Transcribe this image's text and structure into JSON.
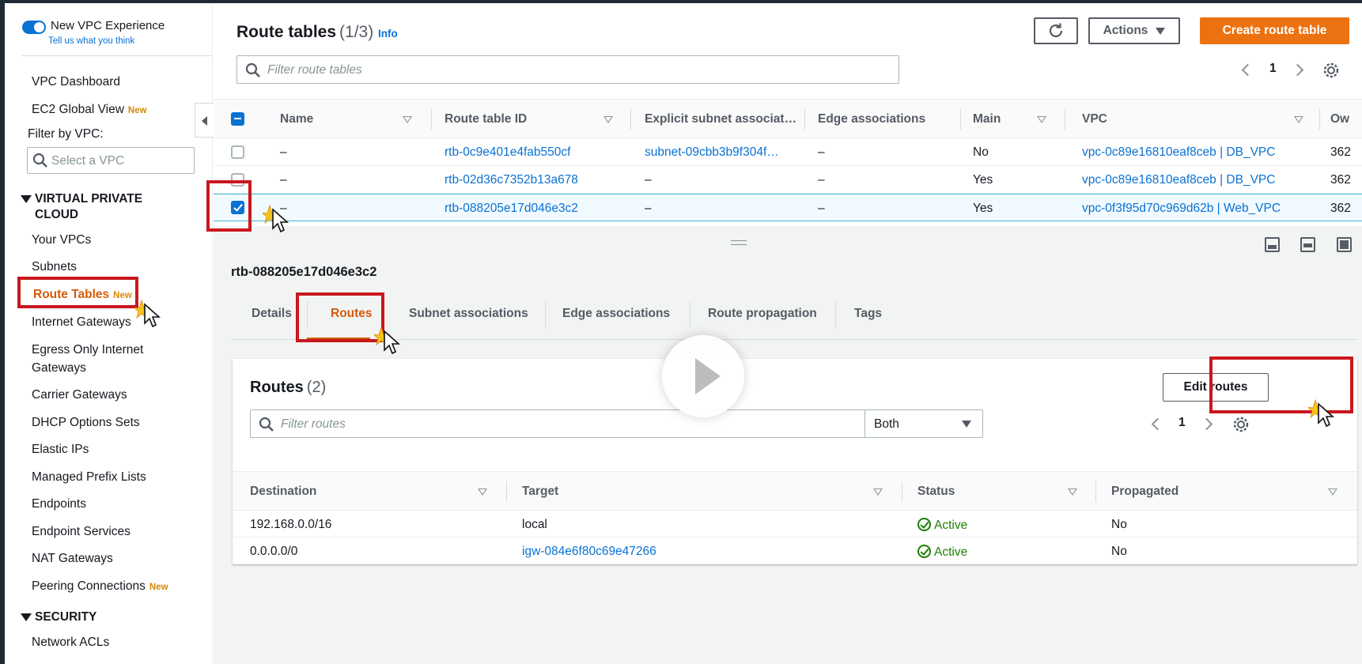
{
  "sidebar": {
    "toggle_label": "New VPC Experience",
    "feedback_link": "Tell us what you think",
    "items_top": [
      {
        "label": "VPC Dashboard",
        "badge": ""
      },
      {
        "label": "EC2 Global View",
        "badge": "New"
      }
    ],
    "filter_label": "Filter by VPC:",
    "filter_placeholder": "Select a VPC",
    "section_vpc": "VIRTUAL PRIVATE CLOUD",
    "vpc_items": [
      {
        "label": "Your VPCs",
        "badge": ""
      },
      {
        "label": "Subnets",
        "badge": ""
      },
      {
        "label": "Route Tables",
        "badge": "New",
        "active": true
      },
      {
        "label": "Internet Gateways",
        "badge": ""
      },
      {
        "label": "Egress Only Internet Gateways",
        "badge": ""
      },
      {
        "label": "Carrier Gateways",
        "badge": ""
      },
      {
        "label": "DHCP Options Sets",
        "badge": ""
      },
      {
        "label": "Elastic IPs",
        "badge": ""
      },
      {
        "label": "Managed Prefix Lists",
        "badge": ""
      },
      {
        "label": "Endpoints",
        "badge": ""
      },
      {
        "label": "Endpoint Services",
        "badge": ""
      },
      {
        "label": "NAT Gateways",
        "badge": ""
      },
      {
        "label": "Peering Connections",
        "badge": "New"
      }
    ],
    "section_security": "SECURITY",
    "security_items": [
      {
        "label": "Network ACLs",
        "badge": ""
      }
    ]
  },
  "header": {
    "title": "Route tables",
    "count": "(1/3)",
    "info": "Info",
    "actions_label": "Actions",
    "create_label": "Create route table",
    "search_placeholder": "Filter route tables",
    "page": "1"
  },
  "table": {
    "columns": [
      "Name",
      "Route table ID",
      "Explicit subnet associat…",
      "Edge associations",
      "Main",
      "VPC",
      "Ow"
    ],
    "rows": [
      {
        "name": "–",
        "id": "rtb-0c9e401e4fab550cf",
        "subnet": "subnet-09cbb3b9f304f…",
        "edge": "–",
        "main": "No",
        "vpc": "vpc-0c89e16810eaf8ceb | DB_VPC",
        "owner": "362",
        "selected": false
      },
      {
        "name": "–",
        "id": "rtb-02d36c7352b13a678",
        "subnet": "–",
        "edge": "–",
        "main": "Yes",
        "vpc": "vpc-0c89e16810eaf8ceb | DB_VPC",
        "owner": "362",
        "selected": false
      },
      {
        "name": "–",
        "id": "rtb-088205e17d046e3c2",
        "subnet": "–",
        "edge": "–",
        "main": "Yes",
        "vpc": "vpc-0f3f95d70c969d62b | Web_VPC",
        "owner": "362",
        "selected": true
      }
    ]
  },
  "detail": {
    "title": "rtb-088205e17d046e3c2",
    "tabs": [
      "Details",
      "Routes",
      "Subnet associations",
      "Edge associations",
      "Route propagation",
      "Tags"
    ],
    "active_tab": "Routes"
  },
  "routes": {
    "title": "Routes",
    "count": "(2)",
    "edit_label": "Edit routes",
    "search_placeholder": "Filter routes",
    "filter_value": "Both",
    "page": "1",
    "columns": [
      "Destination",
      "Target",
      "Status",
      "Propagated"
    ],
    "rows": [
      {
        "destination": "192.168.0.0/16",
        "target": "local",
        "target_link": false,
        "status": "Active",
        "propagated": "No"
      },
      {
        "destination": "0.0.0.0/0",
        "target": "igw-084e6f80c69e47266",
        "target_link": true,
        "status": "Active",
        "propagated": "No"
      }
    ]
  },
  "colors": {
    "accent_orange": "#ec7211",
    "active_orange": "#d45b07",
    "link_blue": "#0972d3",
    "status_green": "#1d8102",
    "highlight_red": "#c9171e"
  }
}
